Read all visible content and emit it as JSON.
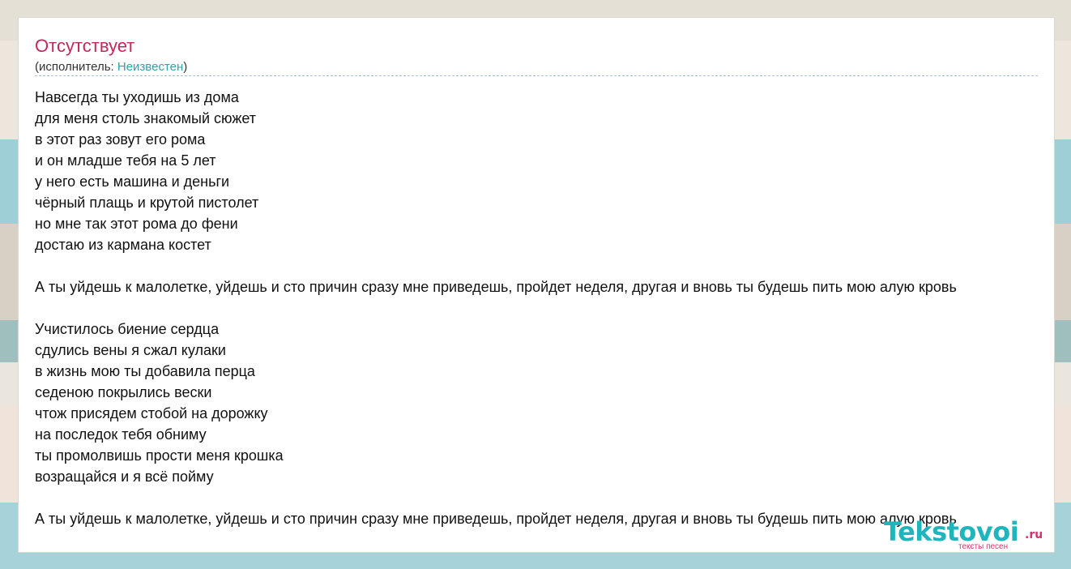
{
  "song": {
    "title": "Отсутствует",
    "artist_prefix": "(исполнитель: ",
    "artist_name": "Неизвестен",
    "artist_suffix": ")"
  },
  "lyrics": {
    "verse1": [
      "Навсегда ты уходишь из дома",
      "для меня столь знакомый сюжет",
      "в этот раз зовут его рома",
      "и он младше тебя на 5 лет",
      "у него есть машина и деньги",
      "чёрный плащь и крутой пистолет",
      "но мне так этот рома до фени",
      "достаю из кармана костет"
    ],
    "chorus1": "А ты уйдешь к малолетке, уйдешь и сто причин сразу мне приведешь, пройдет неделя, другая и вновь ты будешь пить мою алую кровь",
    "verse2": [
      "Учистилось биение сердца",
      "сдулись вены я сжал кулаки",
      "в жизнь мою ты добавила перца",
      "седеною покрылись вески",
      "чтож присядем стобой на дорожку",
      "на последок тебя обниму",
      "ты промолвишь прости меня крошка",
      "возращайся и я всё пойму"
    ],
    "chorus2": "А ты уйдешь к малолетке, уйдешь и сто причин сразу мне приведешь, пройдет неделя, другая и вновь ты будешь пить мою алую кровь"
  },
  "logo": {
    "name": "Tekstovoi",
    "tld": ".ru",
    "tagline": "тексты песен"
  },
  "colors": {
    "title": "#c2285b",
    "artist_link": "#2fa3a8",
    "logo_main": "#1fb5bc",
    "logo_accent": "#d8336a"
  }
}
